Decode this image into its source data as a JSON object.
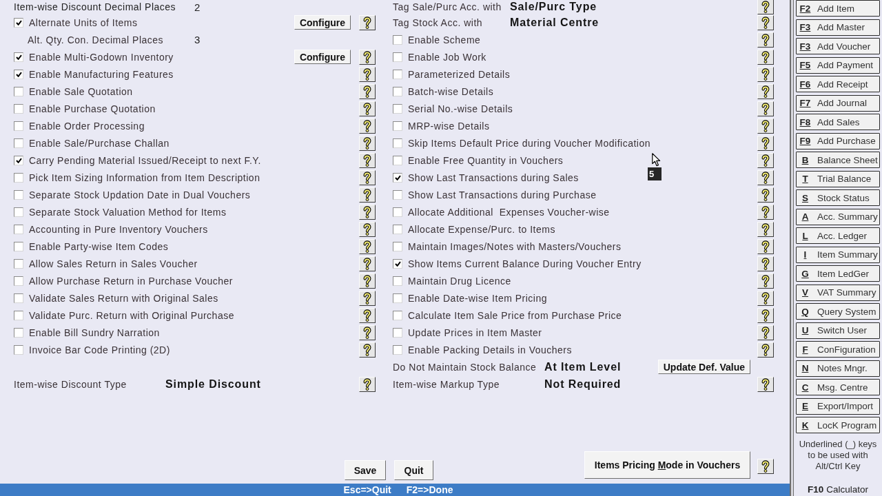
{
  "left_column": {
    "rows": [
      {
        "kind": "value",
        "label": "Item-wise Discount Decimal Places",
        "value": "2",
        "help": false
      },
      {
        "kind": "checkbox",
        "label": "Alternate Units of Items",
        "checked": true,
        "button": "Configure",
        "help": true
      },
      {
        "kind": "subvalue",
        "label": "Alt. Qty. Con. Decimal Places",
        "value": "3",
        "help": false
      },
      {
        "kind": "checkbox",
        "label": "Enable Multi-Godown Inventory",
        "checked": true,
        "button": "Configure",
        "help": true
      },
      {
        "kind": "checkbox",
        "label": "Enable Manufacturing Features",
        "checked": true,
        "help": true
      },
      {
        "kind": "checkbox",
        "label": "Enable Sale Quotation",
        "checked": false,
        "help": true
      },
      {
        "kind": "checkbox",
        "label": "Enable Purchase Quotation",
        "checked": false,
        "help": true
      },
      {
        "kind": "checkbox",
        "label": "Enable Order Processing",
        "checked": false,
        "help": true
      },
      {
        "kind": "checkbox",
        "label": "Enable Sale/Purchase Challan",
        "checked": false,
        "help": true
      },
      {
        "kind": "checkbox",
        "label": "Carry Pending Material Issued/Receipt to next F.Y.",
        "checked": true,
        "help": true
      },
      {
        "kind": "checkbox",
        "label": "Pick Item Sizing Information from Item Description",
        "checked": false,
        "help": true
      },
      {
        "kind": "checkbox",
        "label": "Separate Stock Updation Date in Dual Vouchers",
        "checked": false,
        "help": true
      },
      {
        "kind": "checkbox",
        "label": "Separate Stock Valuation Method for Items",
        "checked": false,
        "help": true
      },
      {
        "kind": "checkbox",
        "label": "Accounting in Pure Inventory Vouchers",
        "checked": false,
        "help": true
      },
      {
        "kind": "checkbox",
        "label": "Enable Party-wise Item Codes",
        "checked": false,
        "help": true
      },
      {
        "kind": "checkbox",
        "label": "Allow Sales Return in Sales Voucher",
        "checked": false,
        "help": true
      },
      {
        "kind": "checkbox",
        "label": "Allow Purchase Return in Purchase Voucher",
        "checked": false,
        "help": true
      },
      {
        "kind": "checkbox",
        "label": "Validate Sales Return with Original Sales",
        "checked": false,
        "help": true
      },
      {
        "kind": "checkbox",
        "label": "Validate Purc. Return with Original Purchase",
        "checked": false,
        "help": true
      },
      {
        "kind": "checkbox",
        "label": "Enable Bill Sundry Narration",
        "checked": false,
        "help": true
      },
      {
        "kind": "checkbox",
        "label": "Invoice Bar Code Printing (2D)",
        "checked": false,
        "help": true
      }
    ],
    "footer_rows": [
      {
        "kind": "choice",
        "label": "Item-wise Discount Type",
        "value": "Simple Discount",
        "help": true
      }
    ]
  },
  "middle_column": {
    "rows": [
      {
        "kind": "choice",
        "label": "Tag Sale/Purc Acc. with",
        "value": "Sale/Purc Type",
        "help": true
      },
      {
        "kind": "choice",
        "label": "Tag Stock Acc. with",
        "value": "Material Centre",
        "help": true
      },
      {
        "kind": "checkbox",
        "label": "Enable Scheme",
        "checked": false,
        "help": true
      },
      {
        "kind": "checkbox",
        "label": "Enable Job Work",
        "checked": false,
        "help": true
      },
      {
        "kind": "checkbox",
        "label": "Parameterized Details",
        "checked": false,
        "help": true
      },
      {
        "kind": "checkbox",
        "label": "Batch-wise Details",
        "checked": false,
        "help": true
      },
      {
        "kind": "checkbox",
        "label": "Serial No.-wise Details",
        "checked": false,
        "help": true
      },
      {
        "kind": "checkbox",
        "label": "MRP-wise Details",
        "checked": false,
        "help": true
      },
      {
        "kind": "checkbox",
        "label": "Skip Items Default Price during Voucher Modification",
        "checked": false,
        "help": true
      },
      {
        "kind": "checkbox",
        "label": "Enable Free Quantity in Vouchers",
        "checked": false,
        "help": true
      },
      {
        "kind": "checkbox",
        "label": "Show Last Transactions during Sales",
        "checked": true,
        "help": true
      },
      {
        "kind": "checkbox",
        "label": "Show Last Transactions during Purchase",
        "checked": false,
        "help": true
      },
      {
        "kind": "checkbox",
        "label": "Allocate Additional  Expenses Voucher-wise",
        "checked": false,
        "help": true
      },
      {
        "kind": "checkbox",
        "label": "Allocate Expense/Purc. to Items",
        "checked": false,
        "help": true
      },
      {
        "kind": "checkbox",
        "label": "Maintain Images/Notes with Masters/Vouchers",
        "checked": false,
        "help": true
      },
      {
        "kind": "checkbox",
        "label": "Show Items Current Balance During Voucher Entry",
        "checked": true,
        "help": true
      },
      {
        "kind": "checkbox",
        "label": "Maintain Drug Licence",
        "checked": false,
        "help": true
      },
      {
        "kind": "checkbox",
        "label": "Enable Date-wise Item Pricing",
        "checked": false,
        "help": true
      },
      {
        "kind": "checkbox",
        "label": "Calculate Item Sale Price from Purchase Price",
        "checked": false,
        "help": true
      },
      {
        "kind": "checkbox",
        "label": "Update Prices in Item Master",
        "checked": false,
        "help": true
      },
      {
        "kind": "checkbox",
        "label": "Enable Packing Details in Vouchers",
        "checked": false,
        "help": true
      }
    ],
    "footer_rows": [
      {
        "kind": "choice",
        "label": "Do Not Maintain Stock Balance",
        "value": "At Item Level",
        "button": "Update Def. Value",
        "help": false
      },
      {
        "kind": "choice",
        "label": "Item-wise Markup Type",
        "value": "Not Required",
        "help": true
      }
    ]
  },
  "actions": {
    "save": "Save",
    "quit": "Quit",
    "pricing_mode": {
      "label_start": "Items Pricing ",
      "access_key": "M",
      "label_end": "ode in Vouchers",
      "help": true
    }
  },
  "pointer": {
    "badge": "5"
  },
  "status_bar": [
    "Esc=>Quit",
    "F2=>Done"
  ],
  "shortcuts": [
    {
      "key": "F2",
      "label": "Add Item"
    },
    {
      "key": "F3",
      "label": "Add Master"
    },
    {
      "key": "F3",
      "label": "Add Voucher"
    },
    {
      "key": "F5",
      "label": "Add Payment"
    },
    {
      "key": "F6",
      "label": "Add Receipt"
    },
    {
      "key": "F7",
      "label": "Add Journal"
    },
    {
      "key": "F8",
      "label": "Add Sales"
    },
    {
      "key": "F9",
      "label": "Add Purchase"
    },
    {
      "key": "B",
      "label": "Balance Sheet"
    },
    {
      "key": "T",
      "label": "Trial Balance"
    },
    {
      "key": "S",
      "label": "Stock Status"
    },
    {
      "key": "A",
      "label": "Acc. Summary"
    },
    {
      "key": "L",
      "label": "Acc. Ledger"
    },
    {
      "key": "I",
      "label": "Item Summary"
    },
    {
      "key": "G",
      "label": "Item LedGer"
    },
    {
      "key": "V",
      "label": "VAT Summary"
    },
    {
      "key": "Q",
      "label": "Query System"
    },
    {
      "key": "U",
      "label": "Switch User"
    },
    {
      "key": "F",
      "label": "ConFiguration"
    },
    {
      "key": "N",
      "label": "Notes Mngr."
    },
    {
      "key": "C",
      "label": "Msg. Centre"
    },
    {
      "key": "E",
      "label": "Export/Import"
    },
    {
      "key": "K",
      "label": "LocK Program"
    }
  ],
  "shortcut_note": "Underlined (_) keys to be used with Alt/Ctrl Key",
  "calculator": {
    "key": "F10",
    "label": "Calculator"
  }
}
